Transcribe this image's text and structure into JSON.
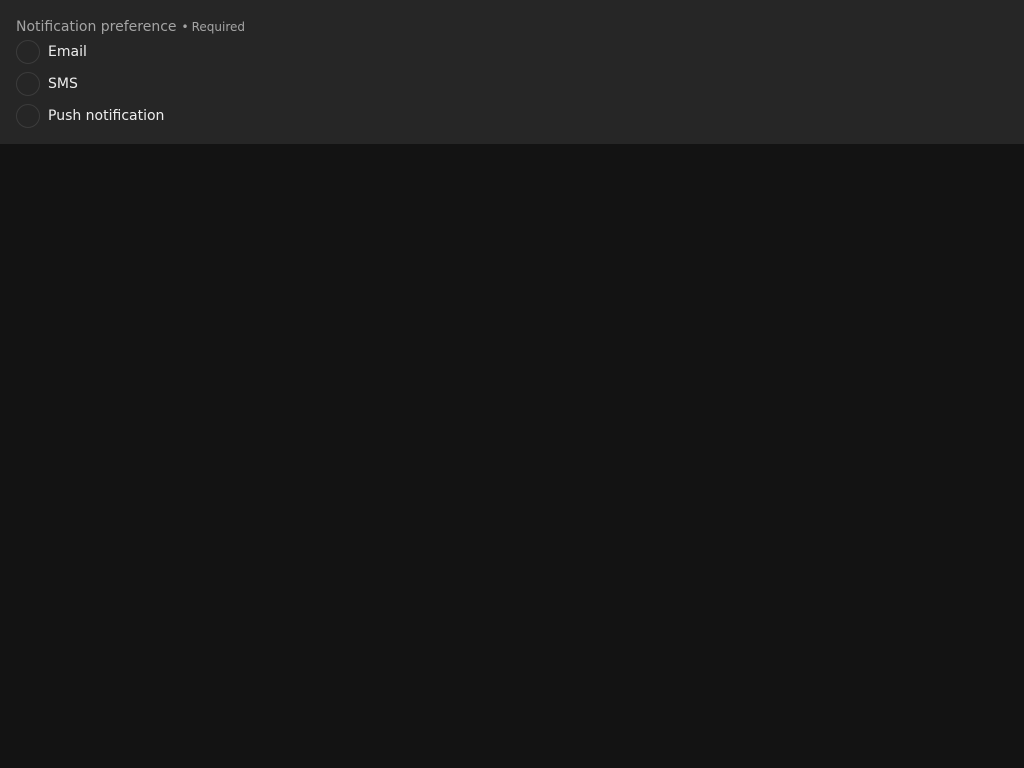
{
  "field": {
    "legend": "Notification preference",
    "separator": "•",
    "required_label": "Required",
    "options": [
      {
        "label": "Email",
        "checked": false
      },
      {
        "label": "SMS",
        "checked": false
      },
      {
        "label": "Push notification",
        "checked": false
      }
    ]
  },
  "colors": {
    "page_background": "#131313",
    "panel_background": "#262626",
    "label_text": "#ededed",
    "muted_text": "#a4a4a4",
    "radio_border": "#3c3c3c"
  }
}
